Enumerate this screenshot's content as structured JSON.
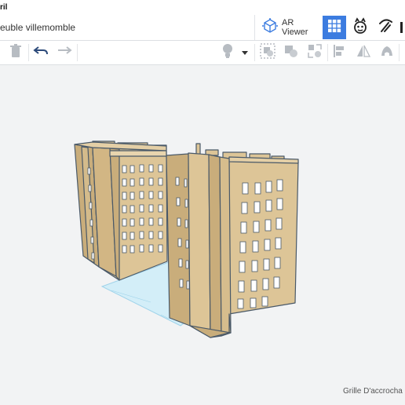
{
  "menu": {
    "label": "ril"
  },
  "project": {
    "title": "euble villemomble"
  },
  "header": {
    "ar_viewer_label": "AR Viewer",
    "tools": [
      {
        "name": "3d-view",
        "icon": "grid-icon",
        "active": true
      },
      {
        "name": "codeblocks",
        "icon": "blocks-face-icon",
        "active": false
      },
      {
        "name": "build",
        "icon": "pickaxe-icon",
        "active": false
      }
    ]
  },
  "toolbar": {
    "items": [
      "trash-icon",
      "undo-icon",
      "redo-icon",
      "light-bulb-icon",
      "dropdown-arrow-icon",
      "group-icon",
      "ungroup-icon",
      "flip-icon",
      "align-icon",
      "mirror-icon",
      "eye-icon"
    ]
  },
  "workplane": {
    "snap_grid_label": "Grille D'accrocha"
  },
  "colors": {
    "accent": "#3c7ce0",
    "building_front": "#ddc597",
    "building_side": "#c9ad7b",
    "outline": "#4a5968",
    "window": "#ffffff",
    "grid": "#cfeaf5"
  }
}
